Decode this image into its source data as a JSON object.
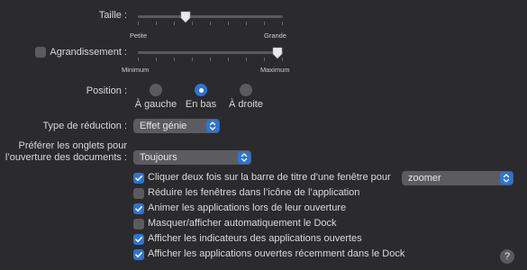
{
  "size": {
    "label": "Taille :",
    "min_label": "Petite",
    "max_label": "Grande",
    "value": 0.33
  },
  "magnification": {
    "label": "Agrandissement :",
    "checked": false,
    "min_label": "Minimum",
    "max_label": "Maximum",
    "value": 1.0
  },
  "position": {
    "label": "Position :",
    "options": [
      {
        "label": "À gauche",
        "selected": false
      },
      {
        "label": "En bas",
        "selected": true
      },
      {
        "label": "À droite",
        "selected": false
      }
    ]
  },
  "minimize_effect": {
    "label": "Type de réduction :",
    "value": "Effet génie"
  },
  "prefer_tabs": {
    "label_line1": "Préférer les onglets pour",
    "label_line2": "l’ouverture des documents :",
    "value": "Toujours"
  },
  "checkboxes": [
    {
      "label": "Cliquer deux fois sur la barre de titre d’une fenêtre pour",
      "checked": true
    },
    {
      "label": "Réduire les fenêtres dans l’icône de l’application",
      "checked": false
    },
    {
      "label": "Animer les applications lors de leur ouverture",
      "checked": true
    },
    {
      "label": "Masquer/afficher automatiquement le Dock",
      "checked": false
    },
    {
      "label": "Afficher les indicateurs des applications ouvertes",
      "checked": true
    },
    {
      "label": "Afficher les applications ouvertes récemment dans le Dock",
      "checked": true
    }
  ],
  "double_click_action": {
    "value": "zoomer"
  },
  "help": {
    "label": "?"
  },
  "colors": {
    "accent": "#2b74d8",
    "background": "#2b2b2d"
  }
}
